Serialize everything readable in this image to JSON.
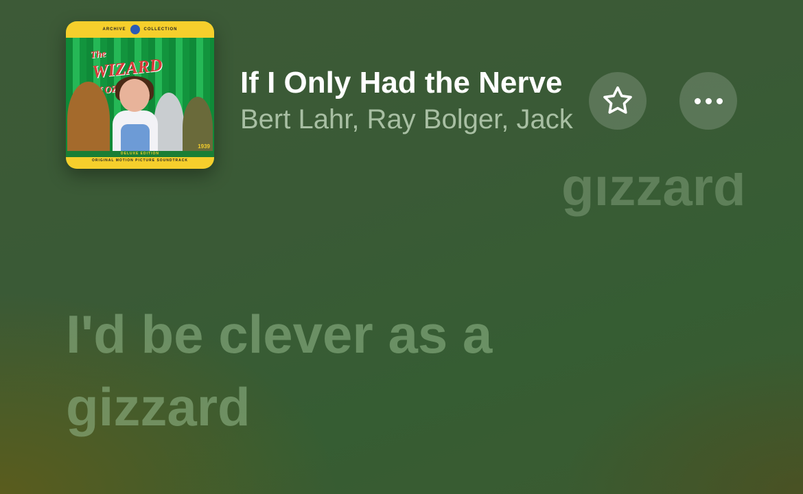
{
  "now_playing": {
    "song_title": "If I Only Had the Nerve",
    "artists": "Bert Lahr, Ray Bolger, Jack Haley",
    "album_art": {
      "top_left_text": "ARCHIVE",
      "top_right_text": "COLLECTION",
      "title_line1": "The",
      "title_line2": "WIZARD",
      "title_line3": "of OZ",
      "year": "1939",
      "edition": "DELUXE EDITION",
      "soundtrack": "ORIGINAL MOTION PICTURE SOUNDTRACK"
    }
  },
  "buttons": {
    "favorite_icon": "star-icon",
    "more_icon": "ellipsis-icon"
  },
  "lyrics": {
    "previous_line_fragment": "gizzard",
    "current_line": "I'd be clever as a gizzard"
  },
  "colors": {
    "background_green": "#3a5a36",
    "background_olive": "#5c5c1c",
    "title_text": "#ffffff"
  }
}
